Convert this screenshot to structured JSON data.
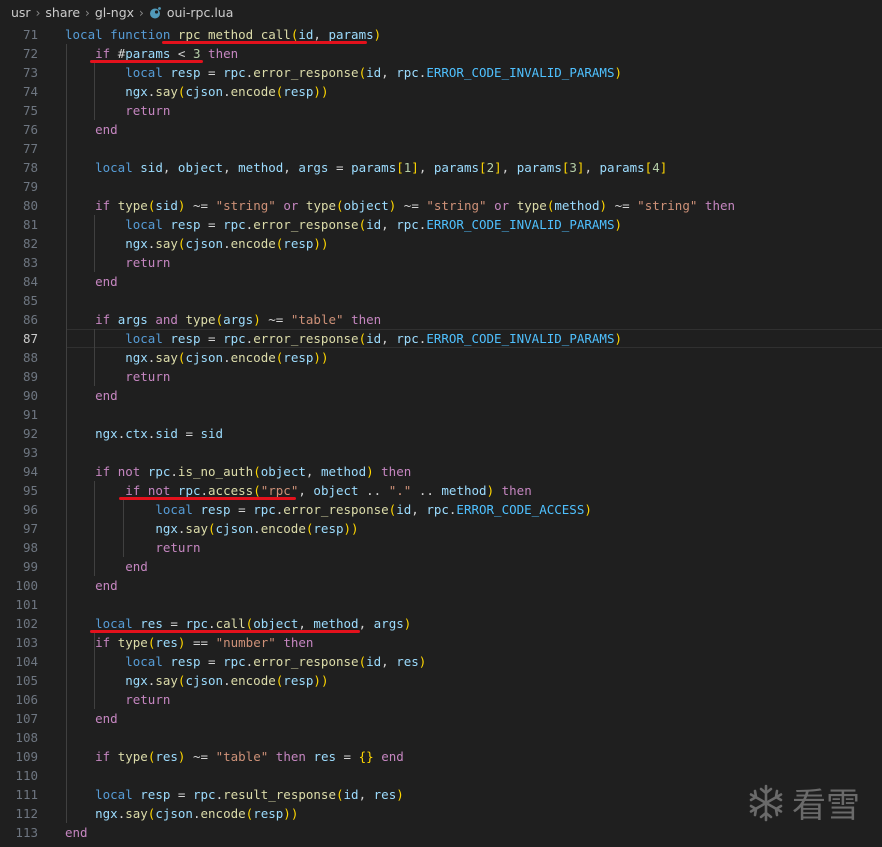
{
  "breadcrumb": {
    "items": [
      "usr",
      "share",
      "gl-ngx"
    ],
    "file": "oui-rpc.lua"
  },
  "editor": {
    "active_line": "87",
    "lines": [
      {
        "n": "71",
        "text": "local function rpc_method_call(id, params)"
      },
      {
        "n": "72",
        "text": "    if #params < 3 then"
      },
      {
        "n": "73",
        "text": "        local resp = rpc.error_response(id, rpc.ERROR_CODE_INVALID_PARAMS)"
      },
      {
        "n": "74",
        "text": "        ngx.say(cjson.encode(resp))"
      },
      {
        "n": "75",
        "text": "        return"
      },
      {
        "n": "76",
        "text": "    end"
      },
      {
        "n": "77",
        "text": ""
      },
      {
        "n": "78",
        "text": "    local sid, object, method, args = params[1], params[2], params[3], params[4]"
      },
      {
        "n": "79",
        "text": ""
      },
      {
        "n": "80",
        "text": "    if type(sid) ~= \"string\" or type(object) ~= \"string\" or type(method) ~= \"string\" then"
      },
      {
        "n": "81",
        "text": "        local resp = rpc.error_response(id, rpc.ERROR_CODE_INVALID_PARAMS)"
      },
      {
        "n": "82",
        "text": "        ngx.say(cjson.encode(resp))"
      },
      {
        "n": "83",
        "text": "        return"
      },
      {
        "n": "84",
        "text": "    end"
      },
      {
        "n": "85",
        "text": ""
      },
      {
        "n": "86",
        "text": "    if args and type(args) ~= \"table\" then"
      },
      {
        "n": "87",
        "text": "        local resp = rpc.error_response(id, rpc.ERROR_CODE_INVALID_PARAMS)"
      },
      {
        "n": "88",
        "text": "        ngx.say(cjson.encode(resp))"
      },
      {
        "n": "89",
        "text": "        return"
      },
      {
        "n": "90",
        "text": "    end"
      },
      {
        "n": "91",
        "text": ""
      },
      {
        "n": "92",
        "text": "    ngx.ctx.sid = sid"
      },
      {
        "n": "93",
        "text": ""
      },
      {
        "n": "94",
        "text": "    if not rpc.is_no_auth(object, method) then"
      },
      {
        "n": "95",
        "text": "        if not rpc.access(\"rpc\", object .. \".\" .. method) then"
      },
      {
        "n": "96",
        "text": "            local resp = rpc.error_response(id, rpc.ERROR_CODE_ACCESS)"
      },
      {
        "n": "97",
        "text": "            ngx.say(cjson.encode(resp))"
      },
      {
        "n": "98",
        "text": "            return"
      },
      {
        "n": "99",
        "text": "        end"
      },
      {
        "n": "100",
        "text": "    end"
      },
      {
        "n": "101",
        "text": ""
      },
      {
        "n": "102",
        "text": "    local res = rpc.call(object, method, args)"
      },
      {
        "n": "103",
        "text": "    if type(res) == \"number\" then"
      },
      {
        "n": "104",
        "text": "        local resp = rpc.error_response(id, res)"
      },
      {
        "n": "105",
        "text": "        ngx.say(cjson.encode(resp))"
      },
      {
        "n": "106",
        "text": "        return"
      },
      {
        "n": "107",
        "text": "    end"
      },
      {
        "n": "108",
        "text": ""
      },
      {
        "n": "109",
        "text": "    if type(res) ~= \"table\" then res = {} end"
      },
      {
        "n": "110",
        "text": ""
      },
      {
        "n": "111",
        "text": "    local resp = rpc.result_response(id, res)"
      },
      {
        "n": "112",
        "text": "    ngx.say(cjson.encode(resp))"
      },
      {
        "n": "113",
        "text": "end"
      }
    ]
  },
  "watermark": {
    "text": "看雪",
    "icon": "snowflake-icon"
  },
  "colors": {
    "annotation_underline": "#e3111c",
    "background": "#1f1f1f"
  }
}
